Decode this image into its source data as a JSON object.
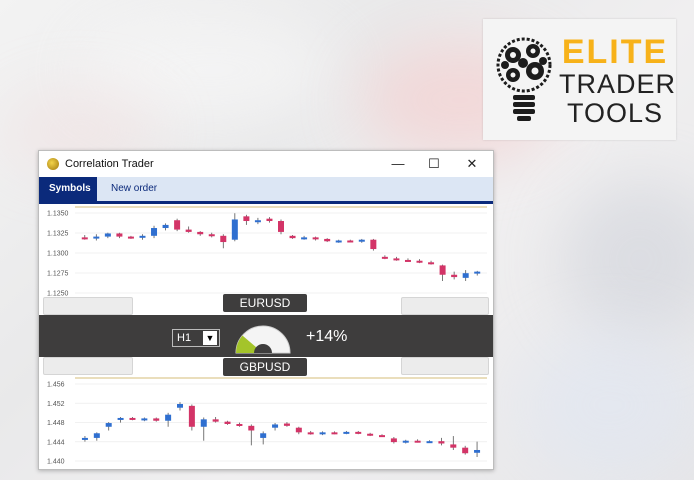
{
  "logo": {
    "word1": "ELITE",
    "word2": "TRADER",
    "word3": "TOOLS",
    "accent": "#f7b21a",
    "icon": "lightbulb-gears-icon"
  },
  "window": {
    "title": "Correlation Trader",
    "controls": {
      "minimize": "—",
      "maximize": "☐",
      "close": "✕"
    },
    "tabs": [
      {
        "label": "Symbols"
      },
      {
        "label": "New order"
      }
    ]
  },
  "symbols": {
    "top": "EURUSD",
    "bottom": "GBPUSD"
  },
  "timeframe": {
    "value": "H1",
    "dropdown_icon": "chevron-down-icon"
  },
  "correlation": {
    "value": "+14%",
    "gauge_fraction": 0.14,
    "gauge_color": "#a4c42a"
  },
  "colors": {
    "up": "#2f6fd0",
    "down": "#d33467",
    "accent": "#0b2a7b"
  },
  "chart_data": [
    {
      "type": "candlestick",
      "symbol": "EURUSD",
      "y_ticks": [
        "1.1350",
        "1.1325",
        "1.1300",
        "1.1275",
        "1.1250"
      ],
      "ylim": [
        1.1242,
        1.1355
      ],
      "candles": [
        [
          1.1316,
          1.1319,
          1.1313,
          1.1315
        ],
        [
          1.1315,
          1.132,
          1.1312,
          1.1317
        ],
        [
          1.1317,
          1.1322,
          1.1315,
          1.1321
        ],
        [
          1.1321,
          1.1322,
          1.1315,
          1.1317
        ],
        [
          1.1317,
          1.1318,
          1.1314,
          1.1316
        ],
        [
          1.1316,
          1.132,
          1.1313,
          1.1318
        ],
        [
          1.1318,
          1.1331,
          1.1315,
          1.1328
        ],
        [
          1.1328,
          1.1334,
          1.1325,
          1.1332
        ],
        [
          1.1338,
          1.134,
          1.1324,
          1.1326
        ],
        [
          1.1326,
          1.133,
          1.1322,
          1.1323
        ],
        [
          1.1323,
          1.1324,
          1.1318,
          1.132
        ],
        [
          1.132,
          1.1322,
          1.1316,
          1.1318
        ],
        [
          1.1318,
          1.132,
          1.1302,
          1.131
        ],
        [
          1.1313,
          1.1347,
          1.1311,
          1.1339
        ],
        [
          1.1343,
          1.1345,
          1.1332,
          1.1337
        ],
        [
          1.1336,
          1.1341,
          1.1333,
          1.1338
        ],
        [
          1.134,
          1.1342,
          1.1335,
          1.1337
        ],
        [
          1.1337,
          1.1339,
          1.132,
          1.1323
        ],
        [
          1.1318,
          1.1319,
          1.1314,
          1.1315
        ],
        [
          1.1315,
          1.1318,
          1.1313,
          1.1316
        ],
        [
          1.1316,
          1.1317,
          1.1312,
          1.1314
        ],
        [
          1.1314,
          1.1315,
          1.131,
          1.1311
        ],
        [
          1.1311,
          1.1313,
          1.1309,
          1.1312
        ],
        [
          1.1312,
          1.1313,
          1.131,
          1.1311
        ],
        [
          1.1311,
          1.1314,
          1.1309,
          1.1313
        ],
        [
          1.1313,
          1.1314,
          1.1299,
          1.1301
        ],
        [
          1.1291,
          1.1293,
          1.1288,
          1.1289
        ],
        [
          1.1289,
          1.1291,
          1.1286,
          1.1287
        ],
        [
          1.1287,
          1.1289,
          1.1285,
          1.1286
        ],
        [
          1.1286,
          1.1288,
          1.1283,
          1.1284
        ],
        [
          1.1284,
          1.1286,
          1.1281,
          1.1282
        ],
        [
          1.128,
          1.1281,
          1.126,
          1.1268
        ],
        [
          1.1268,
          1.1272,
          1.1262,
          1.1265
        ],
        [
          1.1264,
          1.1274,
          1.126,
          1.127
        ],
        [
          1.127,
          1.1273,
          1.1267,
          1.1272
        ]
      ]
    },
    {
      "type": "candlestick",
      "symbol": "GBPUSD",
      "y_ticks": [
        "1.456",
        "1.452",
        "1.448",
        "1.444",
        "1.440"
      ],
      "ylim": [
        1.4392,
        1.4575
      ],
      "candles": [
        [
          1.4443,
          1.445,
          1.4438,
          1.4446
        ],
        [
          1.4446,
          1.4458,
          1.444,
          1.4456
        ],
        [
          1.447,
          1.448,
          1.4462,
          1.4478
        ],
        [
          1.4485,
          1.4491,
          1.4479,
          1.4489
        ],
        [
          1.4489,
          1.4491,
          1.4484,
          1.4486
        ],
        [
          1.4486,
          1.449,
          1.4482,
          1.4488
        ],
        [
          1.4488,
          1.449,
          1.4481,
          1.4483
        ],
        [
          1.4483,
          1.45,
          1.447,
          1.4496
        ],
        [
          1.4511,
          1.4523,
          1.4505,
          1.4519
        ],
        [
          1.4515,
          1.4518,
          1.4462,
          1.447
        ],
        [
          1.447,
          1.449,
          1.444,
          1.4486
        ],
        [
          1.4486,
          1.4491,
          1.4479,
          1.4481
        ],
        [
          1.4481,
          1.4483,
          1.4474,
          1.4476
        ],
        [
          1.4476,
          1.4479,
          1.447,
          1.4472
        ],
        [
          1.4472,
          1.4475,
          1.443,
          1.4462
        ],
        [
          1.4446,
          1.446,
          1.4432,
          1.4456
        ],
        [
          1.4468,
          1.4478,
          1.4462,
          1.4475
        ],
        [
          1.4477,
          1.448,
          1.447,
          1.4472
        ],
        [
          1.4468,
          1.447,
          1.4454,
          1.4458
        ],
        [
          1.4458,
          1.4461,
          1.4453,
          1.4455
        ],
        [
          1.4455,
          1.446,
          1.4452,
          1.4458
        ],
        [
          1.4458,
          1.446,
          1.4454,
          1.4456
        ],
        [
          1.4456,
          1.4461,
          1.4454,
          1.4459
        ],
        [
          1.4459,
          1.4461,
          1.4454,
          1.4455
        ],
        [
          1.4455,
          1.4457,
          1.445,
          1.4452
        ],
        [
          1.4452,
          1.4454,
          1.4448,
          1.4449
        ],
        [
          1.4445,
          1.4448,
          1.4434,
          1.4437
        ],
        [
          1.4437,
          1.4442,
          1.4434,
          1.444
        ],
        [
          1.444,
          1.4443,
          1.4436,
          1.4438
        ],
        [
          1.4438,
          1.4441,
          1.4435,
          1.4439
        ],
        [
          1.4439,
          1.4446,
          1.443,
          1.4434
        ],
        [
          1.4432,
          1.445,
          1.442,
          1.4425
        ],
        [
          1.4425,
          1.4429,
          1.441,
          1.4413
        ],
        [
          1.4414,
          1.4438,
          1.4405,
          1.442
        ]
      ]
    }
  ]
}
